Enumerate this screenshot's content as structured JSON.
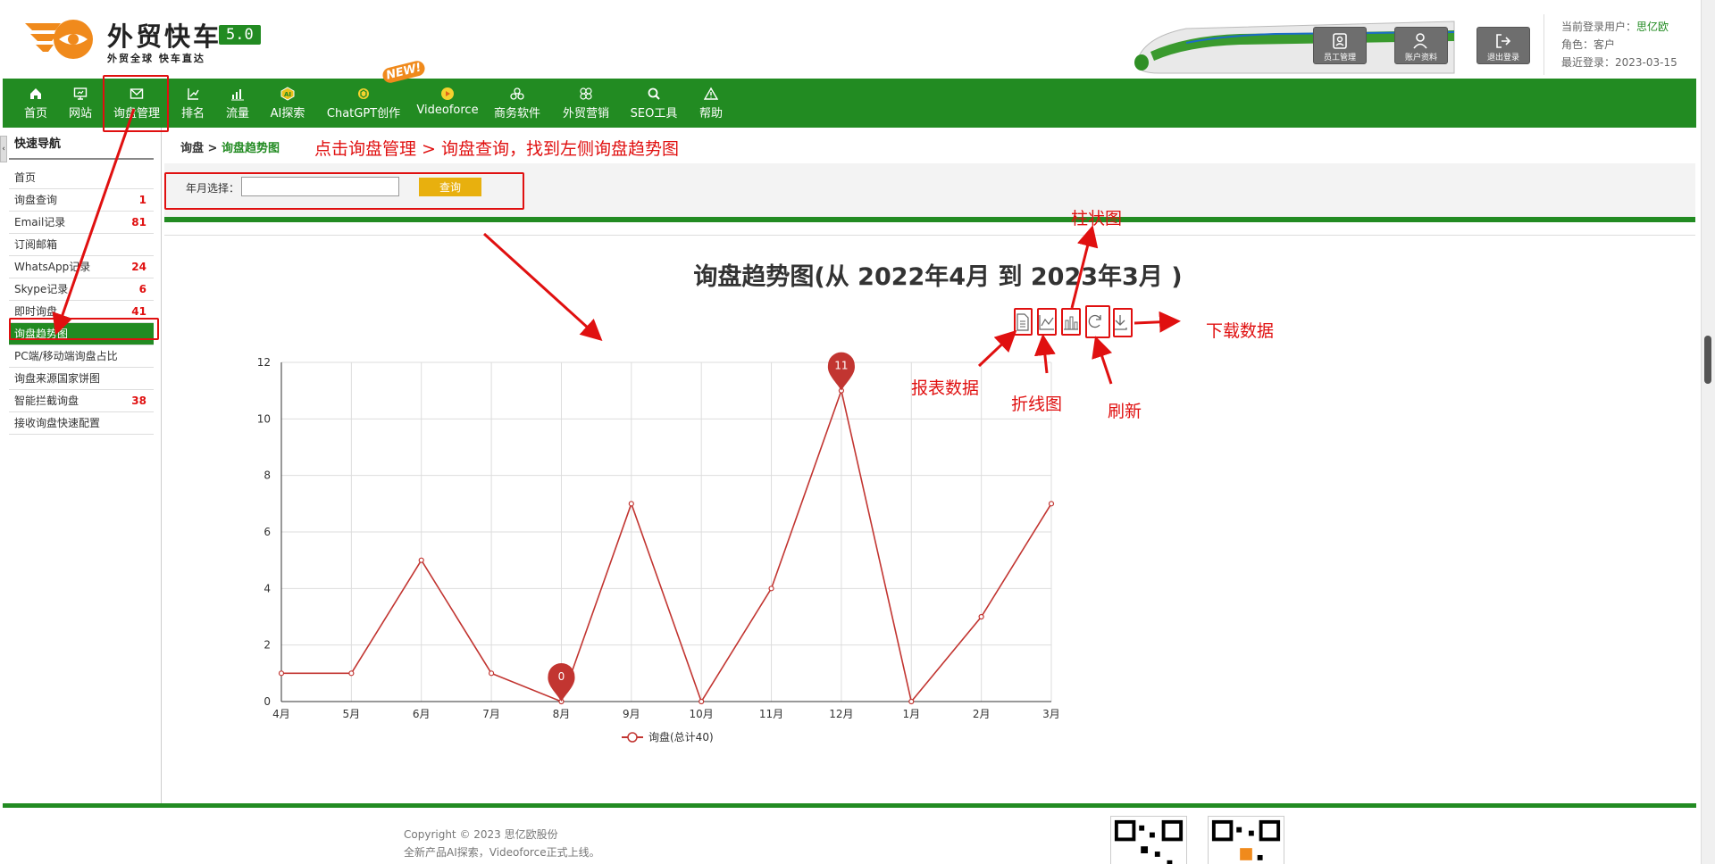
{
  "header": {
    "brand": "外贸快车",
    "version": "5.0",
    "slogan": "外贸全球 快车直达",
    "buttons": [
      {
        "label": "员工管理",
        "icon": "staff-icon"
      },
      {
        "label": "账户资料",
        "icon": "account-icon"
      },
      {
        "label": "退出登录",
        "icon": "logout-icon"
      }
    ],
    "user": {
      "current_label": "当前登录用户：",
      "current_value": "思亿欧",
      "role_label": "角色：",
      "role_value": "客户",
      "last_login_label": "最近登录：",
      "last_login_value": "2023-03-15"
    }
  },
  "nav": {
    "items": [
      {
        "label": "首页",
        "icon": "home-icon"
      },
      {
        "label": "网站",
        "icon": "monitor-icon"
      },
      {
        "label": "询盘管理",
        "icon": "mail-icon"
      },
      {
        "label": "排名",
        "icon": "ranking-icon"
      },
      {
        "label": "流量",
        "icon": "bar-chart-icon"
      },
      {
        "label": "AI探索",
        "icon": "ai-icon"
      },
      {
        "label": "ChatGPT创作",
        "icon": "chatgpt-icon"
      },
      {
        "label": "Videoforce",
        "icon": "video-icon"
      },
      {
        "label": "商务软件",
        "icon": "software-icon"
      },
      {
        "label": "外贸营销",
        "icon": "marketing-icon"
      },
      {
        "label": "SEO工具",
        "icon": "search-icon"
      },
      {
        "label": "帮助",
        "icon": "warning-icon"
      }
    ],
    "new_badge": "NEW!"
  },
  "sidebar": {
    "title": "快速导航",
    "items": [
      {
        "label": "首页",
        "count": ""
      },
      {
        "label": "询盘查询",
        "count": "1"
      },
      {
        "label": "Email记录",
        "count": "81"
      },
      {
        "label": "订阅邮箱",
        "count": ""
      },
      {
        "label": "WhatsApp记录",
        "count": "24"
      },
      {
        "label": "Skype记录",
        "count": "6"
      },
      {
        "label": "即时询盘",
        "count": "41"
      },
      {
        "label": "询盘趋势图",
        "count": ""
      },
      {
        "label": "PC端/移动端询盘占比",
        "count": ""
      },
      {
        "label": "询盘来源国家饼图",
        "count": ""
      },
      {
        "label": "智能拦截询盘",
        "count": "38"
      },
      {
        "label": "接收询盘快速配置",
        "count": ""
      }
    ]
  },
  "breadcrumb": {
    "root": "询盘",
    "sep": " > ",
    "current": "询盘趋势图"
  },
  "search": {
    "label": "年月选择：",
    "value": "",
    "button": "查询"
  },
  "chart_data": {
    "type": "line",
    "title": "询盘趋势图(从 2022年4月 到 2023年3月 )",
    "categories": [
      "4月",
      "5月",
      "6月",
      "7月",
      "8月",
      "9月",
      "10月",
      "11月",
      "12月",
      "1月",
      "2月",
      "3月"
    ],
    "series": [
      {
        "name": "询盘(总计40)",
        "values": [
          1,
          1,
          5,
          1,
          0,
          7,
          0,
          4,
          11,
          0,
          3,
          7
        ],
        "color": "#c23531"
      }
    ],
    "ylim": [
      0,
      12
    ],
    "yticks": [
      0,
      2,
      4,
      6,
      8,
      10,
      12
    ],
    "markers": [
      {
        "label": "0",
        "category": "8月",
        "value": 0
      },
      {
        "label": "11",
        "category": "12月",
        "value": 11
      }
    ],
    "legend": "bottom-center",
    "grid": true
  },
  "toolbox": [
    "data-view-icon",
    "line-chart-icon",
    "bar-chart-icon",
    "refresh-icon",
    "download-icon"
  ],
  "annotations": {
    "instruction": "点击询盘管理 > 询盘查询，找到左侧询盘趋势图",
    "bar": "柱状图",
    "data_view": "报表数据",
    "line": "折线图",
    "refresh": "刷新",
    "download": "下载数据"
  },
  "footer": {
    "copyright": "Copyright © 2023 思亿欧股份",
    "note": "全新产品AI探索，Videoforce正式上线。"
  }
}
